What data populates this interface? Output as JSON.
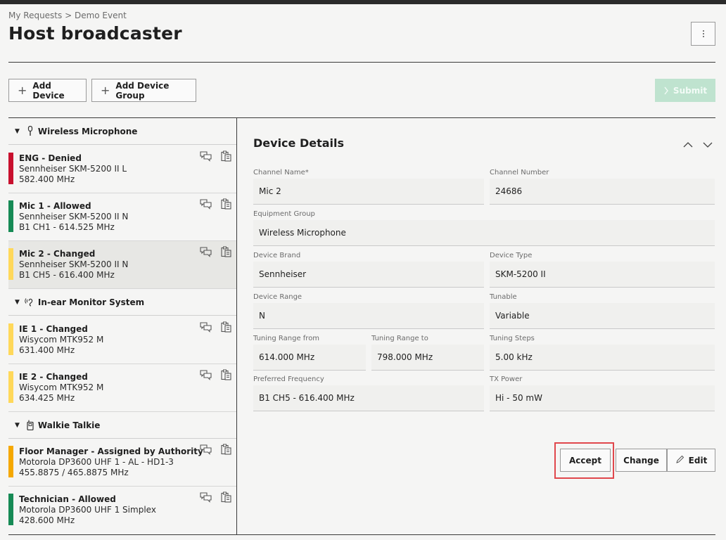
{
  "breadcrumb": "My Requests > Demo Event",
  "page_title": "Host broadcaster",
  "toolbar": {
    "add_device": "Add Device",
    "add_device_group": "Add Device Group",
    "submit": "Submit"
  },
  "groups": [
    {
      "label": "Wireless Microphone",
      "icon": "microphone-icon"
    },
    {
      "label": "In-ear Monitor System",
      "icon": "ear-icon"
    },
    {
      "label": "Walkie Talkie",
      "icon": "walkie-talkie-icon"
    }
  ],
  "devices": [
    {
      "name": "ENG - Denied",
      "model": "Sennheiser SKM-5200 II L",
      "freq": "582.400 MHz",
      "status_color": "#c8102e"
    },
    {
      "name": "Mic 1 - Allowed",
      "model": "Sennheiser SKM-5200 II N",
      "freq": "B1 CH1 - 614.525 MHz",
      "status_color": "#168a55"
    },
    {
      "name": "Mic 2 - Changed",
      "model": "Sennheiser SKM-5200 II N",
      "freq": "B1 CH5 - 616.400 MHz",
      "status_color": "#ffd85a"
    },
    {
      "name": "IE 1 - Changed",
      "model": "Wisycom MTK952 M",
      "freq": "631.400 MHz",
      "status_color": "#ffd85a"
    },
    {
      "name": "IE 2 - Changed",
      "model": "Wisycom MTK952 M",
      "freq": "634.425 MHz",
      "status_color": "#ffd85a"
    },
    {
      "name": "Floor Manager - Assigned by Authority",
      "model": "Motorola DP3600 UHF 1 - AL - HD1-3",
      "freq": "455.8875 / 465.8875 MHz",
      "status_color": "#f5a800"
    },
    {
      "name": "Technician - Allowed",
      "model": "Motorola DP3600 UHF 1 Simplex",
      "freq": "428.600 MHz",
      "status_color": "#168a55"
    }
  ],
  "details": {
    "title": "Device Details",
    "fields": {
      "channel_name": {
        "label": "Channel Name*",
        "value": "Mic 2"
      },
      "channel_number": {
        "label": "Channel Number",
        "value": "24686"
      },
      "equipment_group": {
        "label": "Equipment Group",
        "value": "Wireless Microphone"
      },
      "device_brand": {
        "label": "Device Brand",
        "value": "Sennheiser"
      },
      "device_type": {
        "label": "Device Type",
        "value": "SKM-5200 II"
      },
      "device_range": {
        "label": "Device Range",
        "value": "N"
      },
      "tunable": {
        "label": "Tunable",
        "value": "Variable"
      },
      "tuning_from": {
        "label": "Tuning Range from",
        "value": "614.000 MHz"
      },
      "tuning_to": {
        "label": "Tuning Range to",
        "value": "798.000 MHz"
      },
      "tuning_steps": {
        "label": "Tuning Steps",
        "value": "5.00 kHz"
      },
      "preferred_frequency": {
        "label": "Preferred Frequency",
        "value": "B1 CH5 - 616.400 MHz"
      },
      "tx_power": {
        "label": "TX Power",
        "value": "Hi - 50 mW"
      }
    }
  },
  "actions": {
    "accept": "Accept",
    "change": "Change",
    "edit": "Edit"
  }
}
